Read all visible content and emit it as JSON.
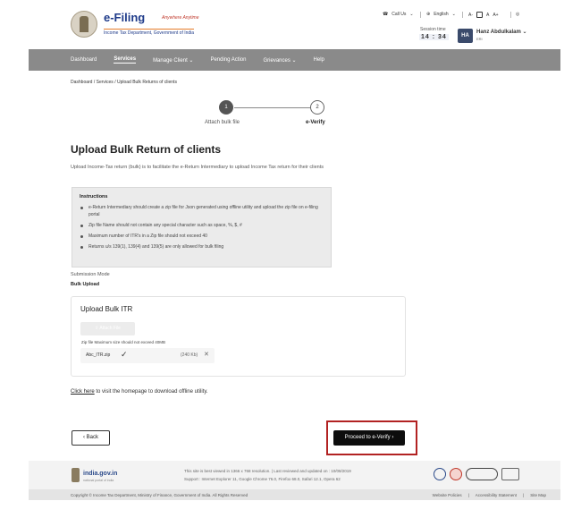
{
  "header": {
    "logo_title": "e-Filing",
    "logo_tagline": "Anywhere Anytime",
    "logo_dept": "Income Tax Department, Government of India",
    "call_us": "Call Us",
    "language": "English",
    "font_small": "A-",
    "font_normal": "A",
    "font_large": "A+",
    "session_label": "Session time",
    "session_time": "14 : 34",
    "avatar_initials": "HA",
    "user_name": "Hanz Abdulkalam",
    "user_role": "ERI"
  },
  "nav": {
    "items": [
      {
        "label": "Dashboard"
      },
      {
        "label": "Services"
      },
      {
        "label": "Manage Client ⌄"
      },
      {
        "label": "Pending Action"
      },
      {
        "label": "Grievances ⌄"
      },
      {
        "label": "Help"
      }
    ],
    "active_index": 1
  },
  "breadcrumb": "Dashboard / Services / Upload Bulk Returns of clients",
  "stepper": {
    "steps": [
      {
        "number": "1",
        "label": "Attach bulk file"
      },
      {
        "number": "2",
        "label": "e-Verify"
      }
    ]
  },
  "main": {
    "title": "Upload Bulk Return of clients",
    "description": "Upload Income-Tax return (bulk) is to facilitate the e-Return Intermediary to upload Income Tax return for their clients",
    "instructions_title": "Instructions",
    "instructions": [
      "e-Return Intermediary should create a zip file for Json generated using offline utility and upload the zip file on e-filing portal",
      "Zip file Name should not contain any special character such as space, %, $, #",
      "Maximum number of ITR's in a Zip file should not exceed 40",
      "Returns u/s 139(1), 139(4) and 139(5) are only allowed for bulk filing"
    ],
    "submission_mode_label": "Submission Mode",
    "submission_mode_value": "Bulk Upload"
  },
  "upload": {
    "title": "Upload Bulk ITR",
    "attach_label": "Attach File",
    "hint": "Zip file Maximum size should not exceed 40MB",
    "file_name": "Abc_ITR.zip",
    "file_check": "✓",
    "file_size": "(240 Kb)",
    "file_remove": "✕"
  },
  "offline": {
    "link": "Click here",
    "text": " to visit the homepage to download offline utility."
  },
  "actions": {
    "back_label": "‹  Back",
    "proceed_label": "Proceed to e-Verify  ›"
  },
  "footer": {
    "india_gov": "india.gov.in",
    "india_gov_sub": "national portal of india",
    "line1": "This site is best viewed in 1366 x 768 resolution.  |  Last reviewed and updated on : 10/08/2019",
    "line2": "Support : Internet Explorer 11, Google Chrome 76.0, Firefox 68.0, Safari 12.1, Opera 62",
    "copyright": "Copyright © Income Tax Department, Ministry of Finance, Government of India. All Rights Reserved",
    "links": [
      "Website Policies",
      "|",
      "Accessibility Statement",
      "|",
      "Site Map"
    ]
  }
}
